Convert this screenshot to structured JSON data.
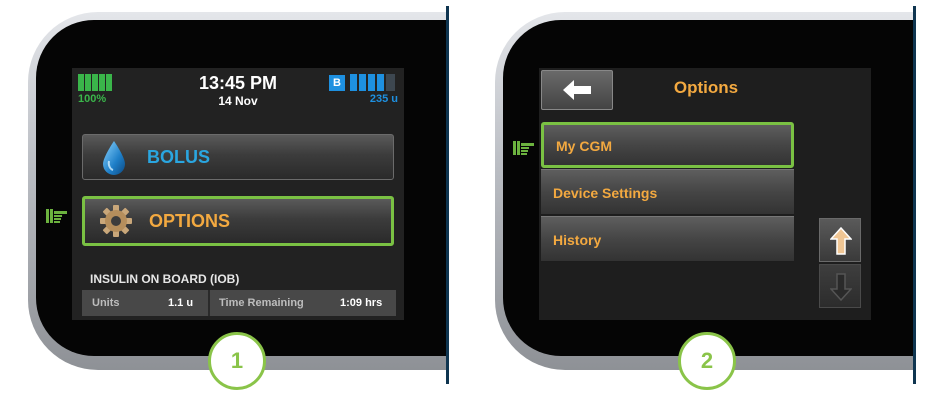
{
  "panel1": {
    "status": {
      "battery_percent": "100%",
      "time": "13:45 PM",
      "date": "14 Nov",
      "cartridge_badge": "B",
      "insulin_units": "235 u"
    },
    "buttons": [
      {
        "label": "BOLUS",
        "icon": "water-drop-icon"
      },
      {
        "label": "OPTIONS",
        "icon": "gear-icon"
      }
    ],
    "iob": {
      "title": "INSULIN ON BOARD (IOB)",
      "units_label": "Units",
      "units_value": "1.1 u",
      "time_label": "Time Remaining",
      "time_value": "1:09 hrs"
    },
    "step_number": "1"
  },
  "panel2": {
    "title": "Options",
    "back_icon": "back-arrow-icon",
    "items": [
      {
        "label": "My CGM"
      },
      {
        "label": "Device Settings"
      },
      {
        "label": "History"
      }
    ],
    "scroll_up_icon": "up-arrow-icon",
    "scroll_down_icon": "down-arrow-icon",
    "step_number": "2"
  },
  "colors": {
    "accent_green": "#7ac143",
    "option_orange": "#f3a940",
    "bolus_blue": "#2aa6e0",
    "battery_green": "#3ab54a",
    "insulin_blue": "#1e90e0"
  }
}
